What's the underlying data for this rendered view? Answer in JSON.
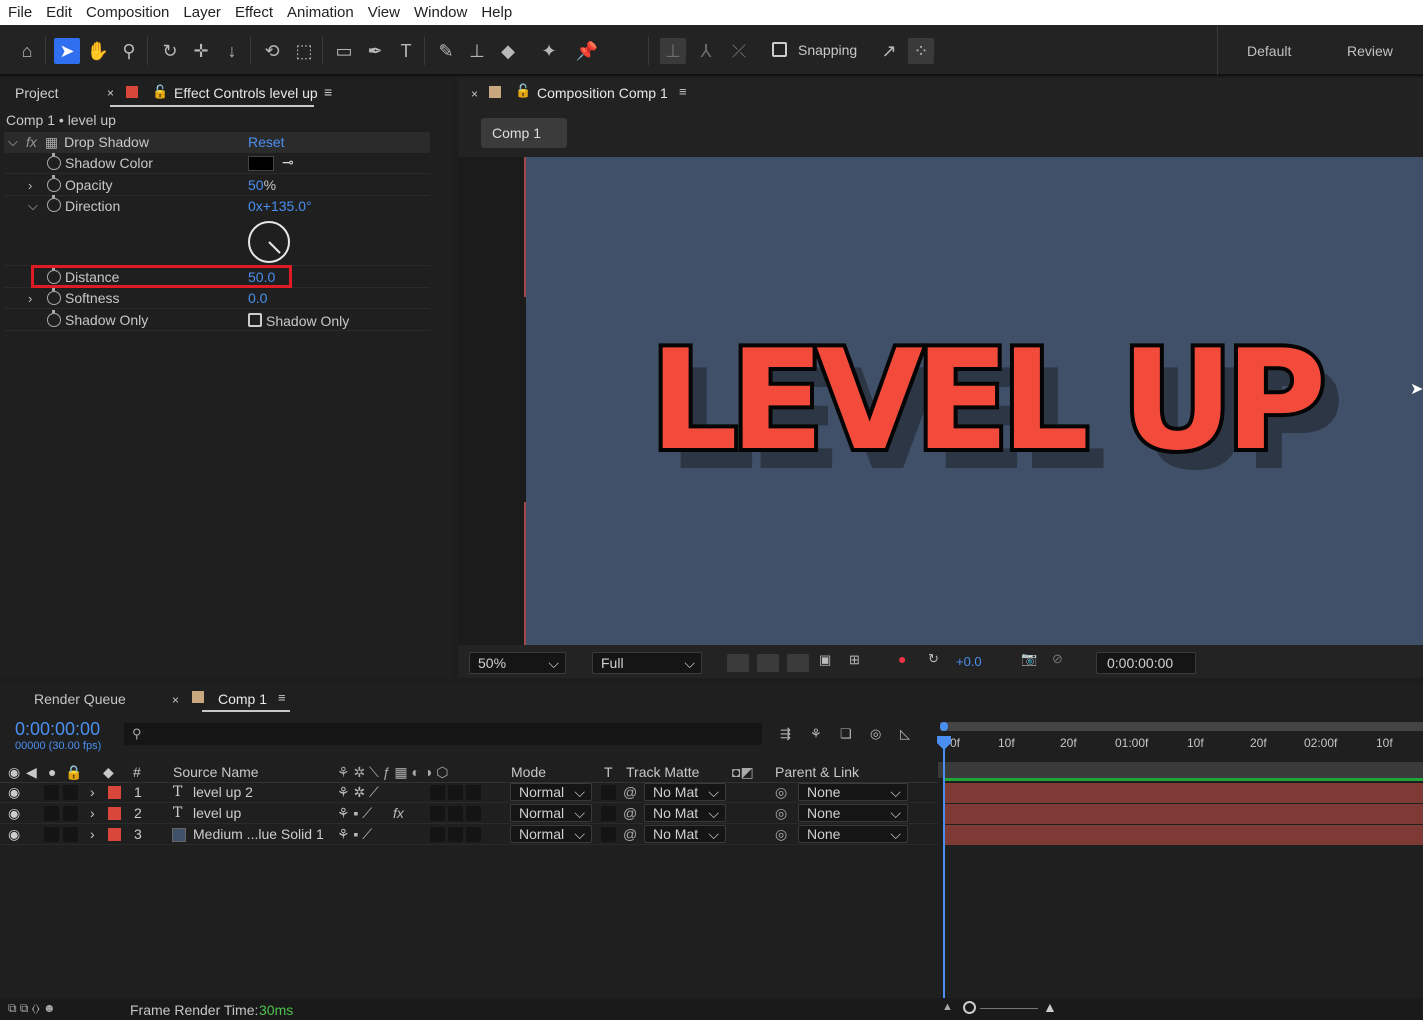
{
  "menu": [
    "File",
    "Edit",
    "Composition",
    "Layer",
    "Effect",
    "Animation",
    "View",
    "Window",
    "Help"
  ],
  "toolbar": {
    "snapping": "Snapping",
    "workspaces": [
      "Default",
      "Review"
    ]
  },
  "effect_panel": {
    "tab_project": "Project",
    "tab_effect": "Effect Controls level up",
    "breadcrumb": "Comp 1 • level up",
    "effect_name": "Drop Shadow",
    "reset": "Reset",
    "fx": "fx",
    "props": [
      {
        "name": "Shadow Color",
        "value": ""
      },
      {
        "name": "Opacity",
        "value_num": "50",
        "value_unit": "%"
      },
      {
        "name": "Direction",
        "value_num": "0x+135.0°",
        "value_unit": ""
      },
      {
        "name": "Distance",
        "value_num": "50.0",
        "value_unit": ""
      },
      {
        "name": "Softness",
        "value_num": "0.0",
        "value_unit": ""
      },
      {
        "name": "Shadow Only",
        "value": "Shadow Only"
      }
    ]
  },
  "comp_panel": {
    "tab": "Composition Comp 1",
    "crumb": "Comp 1",
    "text": "LEVEL UP",
    "zoom": "50%",
    "resolution": "Full",
    "exposure": "+0.0",
    "timecode": "0:00:00:00",
    "accent": "#f24b3c",
    "bg": "#405068"
  },
  "timeline": {
    "tab_render": "Render Queue",
    "tab_comp": "Comp 1",
    "timecode": "0:00:00:00",
    "frames": "00000 (30.00 fps)",
    "search_placeholder": "",
    "headers": {
      "hash": "#",
      "source": "Source Name",
      "mode": "Mode",
      "t": "T",
      "track": "Track Matte",
      "parent": "Parent & Link"
    },
    "ruler": [
      "0f",
      "10f",
      "20f",
      "01:00f",
      "10f",
      "20f",
      "02:00f",
      "10f"
    ],
    "layers": [
      {
        "num": "1",
        "type": "T",
        "name": "level up 2",
        "mode": "Normal",
        "matte": "No Mat",
        "parent": "None",
        "fx": ""
      },
      {
        "num": "2",
        "type": "T",
        "name": "level up",
        "mode": "Normal",
        "matte": "No Mat",
        "parent": "None",
        "fx": "fx"
      },
      {
        "num": "3",
        "type": "",
        "name": "Medium ...lue Solid 1",
        "mode": "Normal",
        "matte": "No Mat",
        "parent": "None",
        "fx": ""
      }
    ]
  },
  "status": {
    "label": "Frame Render Time:",
    "value": "30ms"
  }
}
